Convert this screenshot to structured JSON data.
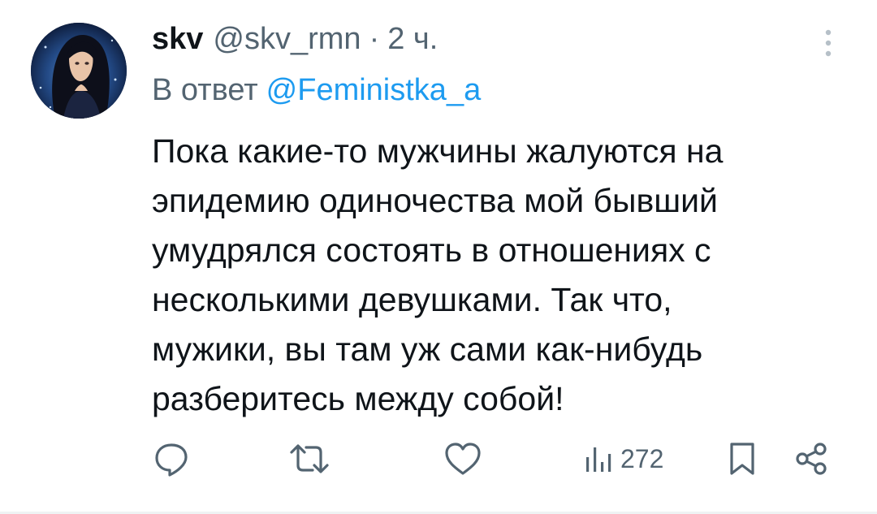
{
  "tweet": {
    "display_name": "skv",
    "handle": "@skv_rmn",
    "separator": "·",
    "time": "2 ч.",
    "reply_prefix": "В ответ",
    "reply_mention": "@Feministka_a",
    "body_lines": [
      "Пока какие-то мужчины жалуются на",
      "эпидемию одиночества мой бывший",
      "умудрялся состоять в отношениях с",
      "несколькими девушками. Так что,",
      "мужики, вы там уж сами как-нибудь",
      "разберитесь между собой!"
    ]
  },
  "actions": {
    "reply_icon": "reply-icon",
    "retweet_icon": "retweet-icon",
    "like_icon": "heart-icon",
    "views_icon": "views-icon",
    "views_count": "272",
    "bookmark_icon": "bookmark-icon",
    "share_icon": "share-icon"
  },
  "colors": {
    "text": "#0f1419",
    "secondary": "#536471",
    "accent": "#1d9bf0"
  }
}
